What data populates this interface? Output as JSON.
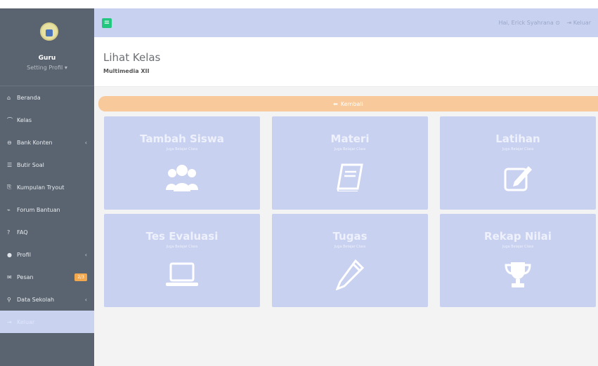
{
  "sidebar": {
    "role": "Guru",
    "setting": "Setting Profil ▾",
    "items": [
      {
        "label": "Beranda",
        "icon": "home-icon",
        "glyph": "⌂"
      },
      {
        "label": "Kelas",
        "icon": "graduation-cap-icon",
        "glyph": "⌒"
      },
      {
        "label": "Bank Konten",
        "icon": "database-icon",
        "glyph": "⊖"
      },
      {
        "label": "Butir Soal",
        "icon": "list-icon",
        "glyph": "☰"
      },
      {
        "label": "Kumpulan Tryout",
        "icon": "document-icon",
        "glyph": "⎘"
      },
      {
        "label": "Forum Bantuan",
        "icon": "megaphone-icon",
        "glyph": "⌁"
      },
      {
        "label": "FAQ",
        "icon": "question-icon",
        "glyph": "?"
      },
      {
        "label": "Profil",
        "icon": "user-icon",
        "glyph": "●"
      },
      {
        "label": "Pesan",
        "icon": "envelope-icon",
        "glyph": "✉",
        "badge": "2/3"
      },
      {
        "label": "Data Sekolah",
        "icon": "search-icon",
        "glyph": "⚲"
      },
      {
        "label": "Keluar",
        "icon": "logout-icon",
        "glyph": "⇥"
      }
    ]
  },
  "topbar": {
    "menu_glyph": "≡",
    "greeting": "Hai, Erick Syahrana ⊙",
    "logout": "⇥ Keluar"
  },
  "header": {
    "title": "Lihat Kelas",
    "subtitle": "Multimedia XII"
  },
  "back_button": {
    "label": "Kembali",
    "glyph": "⬅"
  },
  "cards": [
    {
      "title": "Tambah Siswa",
      "subtitle": "Juga Belajar Class",
      "icon": "users-icon"
    },
    {
      "title": "Materi",
      "subtitle": "Juga Belajar Class",
      "icon": "book-icon"
    },
    {
      "title": "Latihan",
      "subtitle": "Juga Belajar Class",
      "icon": "edit-icon"
    },
    {
      "title": "Tes Evaluasi",
      "subtitle": "Juga Belajar Class",
      "icon": "laptop-icon"
    },
    {
      "title": "Tugas",
      "subtitle": "Juga Belajar Class",
      "icon": "pencil-icon"
    },
    {
      "title": "Rekap Nilai",
      "subtitle": "Juga Belajar Class",
      "icon": "trophy-icon"
    }
  ],
  "colors": {
    "sidebar_bg": "#5a6470",
    "accent": "#c8d1f0",
    "back_button": "#f8c99a",
    "menu_toggle": "#22c67f"
  }
}
